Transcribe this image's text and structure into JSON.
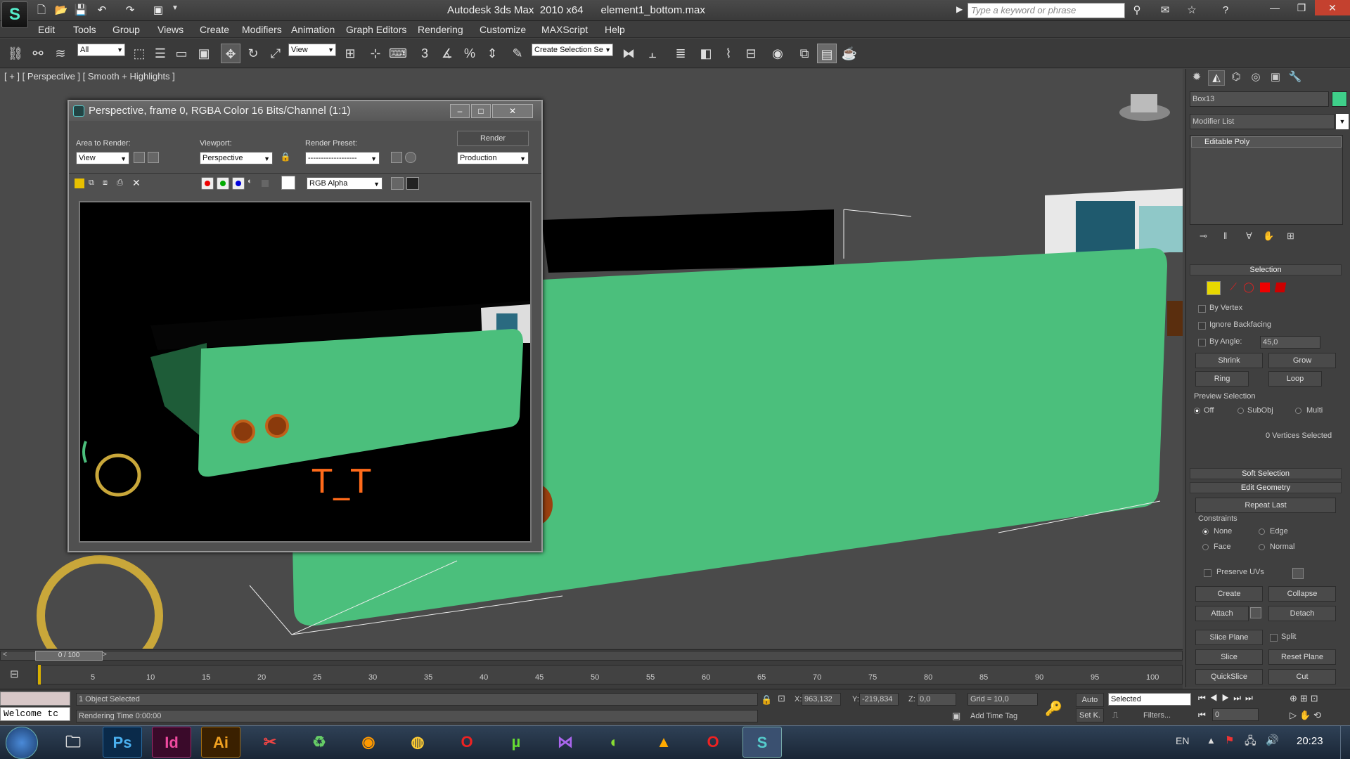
{
  "window": {
    "app_title": "Autodesk 3ds Max  2010 x64",
    "file_name": "element1_bottom.max",
    "search_placeholder": "Type a keyword or phrase"
  },
  "menu": [
    "Edit",
    "Tools",
    "Group",
    "Views",
    "Create",
    "Modifiers",
    "Animation",
    "Graph Editors",
    "Rendering",
    "Customize",
    "MAXScript",
    "Help"
  ],
  "toolbar": {
    "selection_filter": "All",
    "ref_coord": "View",
    "named_selection": "Create Selection Se"
  },
  "viewport": {
    "label": "[ + ] [ Perspective ] [ Smooth + Highlights ]"
  },
  "render_window": {
    "title": "Perspective, frame 0, RGBA Color 16 Bits/Channel (1:1)",
    "area_label": "Area to Render:",
    "area_value": "View",
    "viewport_label": "Viewport:",
    "viewport_value": "Perspective",
    "preset_label": "Render Preset:",
    "preset_value": "-------------------",
    "render_btn": "Render",
    "production_value": "Production",
    "channel_value": "RGB Alpha",
    "annotation": "T_T"
  },
  "command_panel": {
    "object_name": "Box13",
    "object_color": "#3fd08a",
    "modifier_list": "Modifier List",
    "stack_item": "Editable Poly",
    "selection": {
      "title": "Selection",
      "by_vertex": "By Vertex",
      "ignore_backfacing": "Ignore Backfacing",
      "by_angle": "By Angle:",
      "angle_value": "45,0",
      "shrink": "Shrink",
      "grow": "Grow",
      "ring": "Ring",
      "loop": "Loop",
      "preview_title": "Preview Selection",
      "preview_off": "Off",
      "preview_subobj": "SubObj",
      "preview_multi": "Multi",
      "status": "0 Vertices Selected"
    },
    "soft_selection": "Soft Selection",
    "edit_geometry": {
      "title": "Edit Geometry",
      "repeat_last": "Repeat Last",
      "constraints": "Constraints",
      "none": "None",
      "edge": "Edge",
      "face": "Face",
      "normal": "Normal",
      "preserve_uvs": "Preserve UVs",
      "create": "Create",
      "collapse": "Collapse",
      "attach": "Attach",
      "detach": "Detach",
      "slice_plane": "Slice Plane",
      "split": "Split",
      "slice": "Slice",
      "reset_plane": "Reset Plane",
      "quickslice": "QuickSlice",
      "cut": "Cut"
    }
  },
  "timeline": {
    "frame_counter": "0 / 100",
    "ticks": [
      "5",
      "10",
      "15",
      "20",
      "25",
      "30",
      "35",
      "40",
      "45",
      "50",
      "55",
      "60",
      "65",
      "70",
      "75",
      "80",
      "85",
      "90",
      "95",
      "100"
    ]
  },
  "status": {
    "maxscript": "Welcome tc",
    "objects_selected": "1 Object Selected",
    "rendering_time": "Rendering Time  0:00:00",
    "x_label": "X:",
    "x_value": "963,132",
    "y_label": "Y:",
    "y_value": "-219,834",
    "z_label": "Z:",
    "z_value": "0,0",
    "grid": "Grid = 10,0",
    "add_time_tag": "Add Time Tag",
    "auto": "Auto",
    "set_key": "Set K.",
    "key_filter": "Selected",
    "filters": "Filters...",
    "current_frame": "0"
  },
  "taskbar": {
    "lang": "EN",
    "time": "20:23",
    "apps": [
      "Ps",
      "Id",
      "Ai"
    ]
  }
}
